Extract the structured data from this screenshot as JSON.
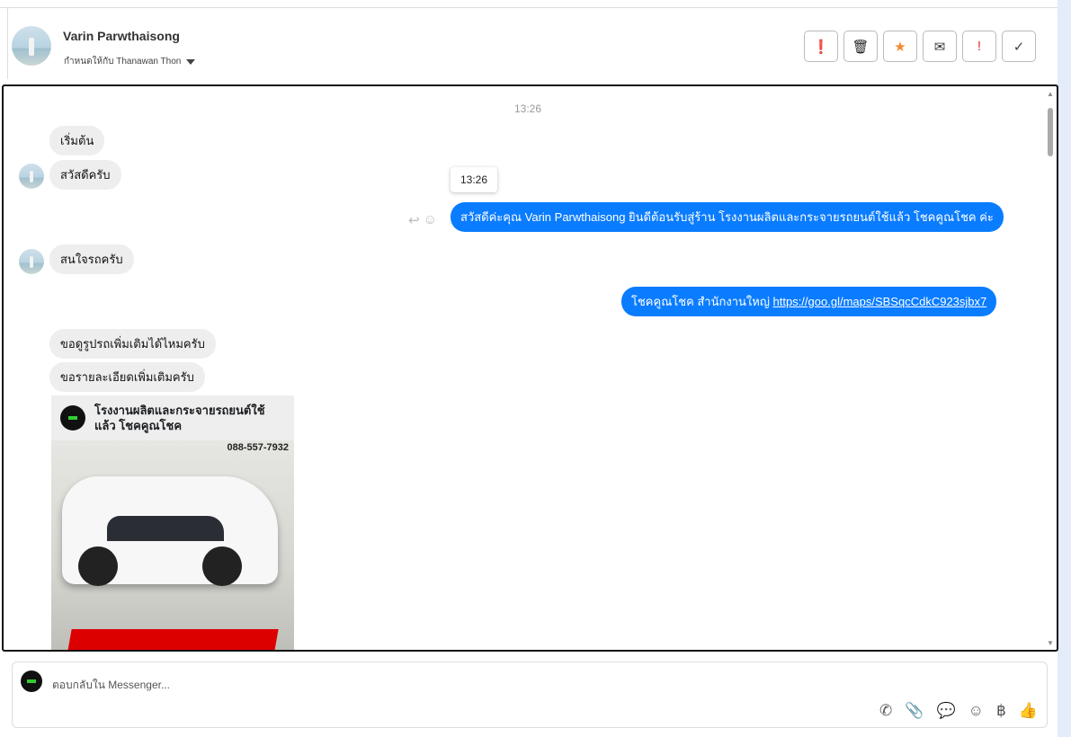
{
  "header": {
    "name": "Varin Parwthaisong",
    "assign_label": "กำหนดให้กับ Thanawan Thon"
  },
  "actions": [
    {
      "name": "spam",
      "glyph": "❗",
      "color": "#222"
    },
    {
      "name": "delete",
      "glyph": "🗑",
      "color": "#222"
    },
    {
      "name": "star",
      "glyph": "★",
      "color": "#f5892b"
    },
    {
      "name": "mark-unread",
      "glyph": "✉",
      "color": "#333"
    },
    {
      "name": "important",
      "glyph": "!",
      "color": "#d33"
    },
    {
      "name": "done",
      "glyph": "✓",
      "color": "#444"
    }
  ],
  "chat": {
    "timestamp": "13:26",
    "tooltip": "13:26",
    "m1": "เริ่มต้น",
    "m2": "สวัสดีครับ",
    "o1": "สวัสดีค่ะคุณ Varin Parwthaisong ยินดีต้อนรับสู่ร้าน โรงงานผลิตและกระจายรถยนต์ใช้แล้ว โชคคูณโชค ค่ะ",
    "m3": "สนใจรถครับ",
    "o2_text": "โชคคูณโชค สำนักงานใหญ่ ",
    "o2_link": "https://goo.gl/maps/SBSqcCdkC923sjbx7",
    "m4": "ขอดูรูปรถเพิ่มเติมได้ไหมครับ",
    "m5": "ขอรายละเอียดเพิ่มเติมครับ",
    "card_title": "โรงงานผลิตและกระจายรถยนต์ใช้แล้ว โชคคูณโชค",
    "card_phone": "088-557-7932"
  },
  "composer": {
    "placeholder": "ตอบกลับใน Messenger..."
  }
}
